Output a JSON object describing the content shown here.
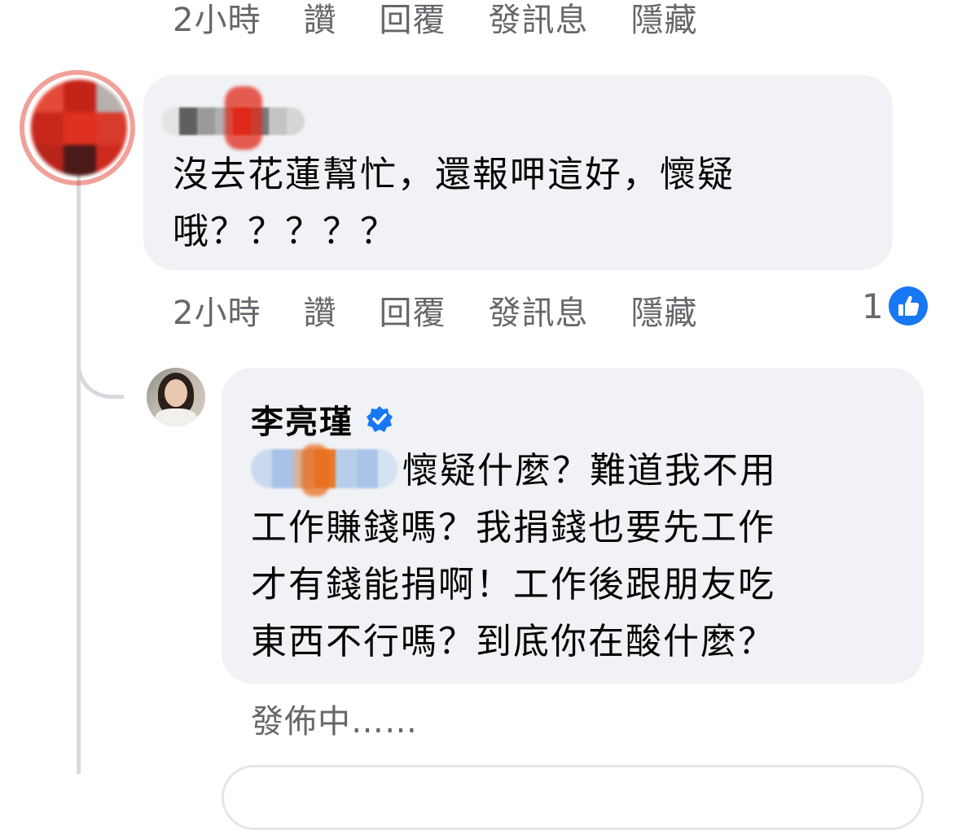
{
  "top_action_bar": {
    "time": "2小時",
    "like": "讚",
    "reply": "回覆",
    "message": "發訊息",
    "hide": "隱藏"
  },
  "comment1": {
    "author_censored": true,
    "text_line1": "沒去花蓮幫忙，還報呷這好，懷疑",
    "text_line2": "哦？？？？？",
    "actions": {
      "time": "2小時",
      "like": "讚",
      "reply": "回覆",
      "message": "發訊息",
      "hide": "隱藏"
    },
    "reaction_count": "1",
    "reaction_icon": "thumbs-up-icon",
    "reaction_color": "#1877f2"
  },
  "reply1": {
    "author": "李亮瑾",
    "verified_icon": "verified-badge-icon",
    "verified_color": "#1877f2",
    "mention_censored": true,
    "text_line1": "懷疑什麼？難道我不用",
    "text_line2": "工作賺錢嗎？我捐錢也要先工作",
    "text_line3": "才有錢能捐啊！工作後跟朋友吃",
    "text_line4": "東西不行嗎？到底你在酸什麼？",
    "status": "發佈中……"
  }
}
